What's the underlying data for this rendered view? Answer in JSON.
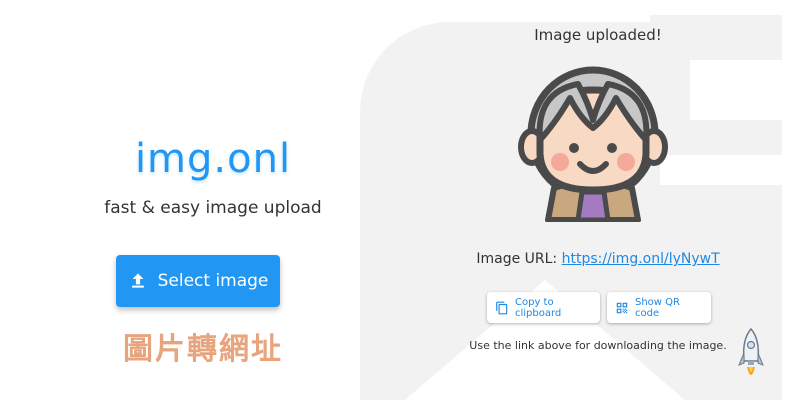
{
  "brand": {
    "name": "img.onl",
    "tagline": "fast & easy image upload",
    "color": "#2196f3"
  },
  "upload": {
    "button_label": "Select image",
    "button_icon": "upload-icon"
  },
  "cjk_label": "圖片轉網址",
  "result": {
    "title": "Image uploaded!",
    "url_label": "Image URL:",
    "url": "https://img.onl/lyNywT",
    "copy_label": "Copy to clipboard",
    "copy_icon": "copy-icon",
    "qr_label": "Show QR code",
    "qr_icon": "qr-code-icon",
    "note": "Use the link above for downloading the image.",
    "image_subject": "grandmother-avatar"
  },
  "colors": {
    "accent": "#2196f3",
    "cjk": "#e8a47c",
    "link": "#1e88e5"
  }
}
